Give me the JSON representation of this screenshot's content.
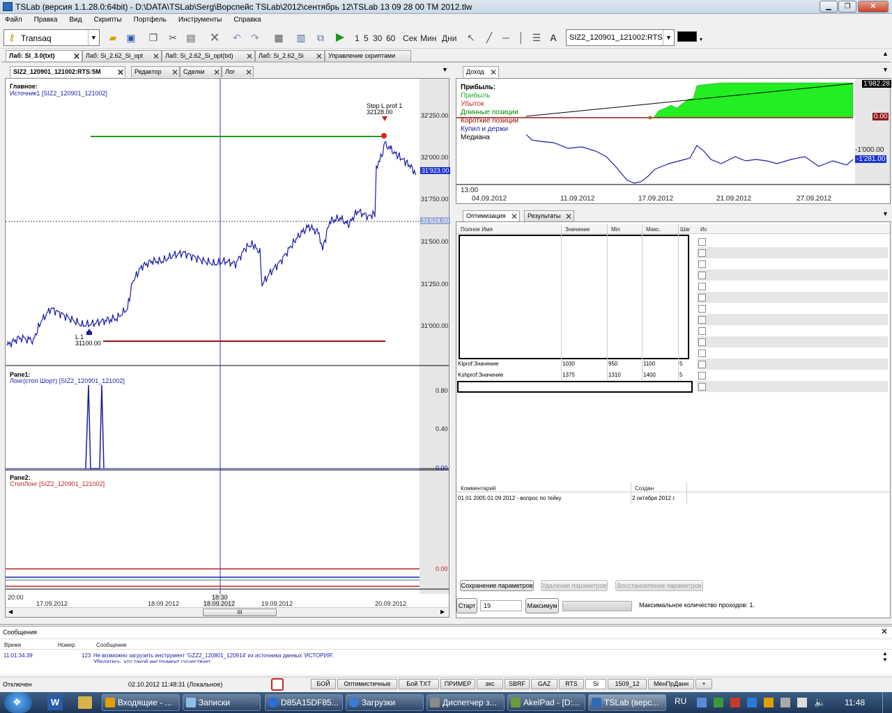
{
  "window": {
    "title": "TSLab (версия 1.1.28.0:64bit) - D:\\DATA\\TSLab\\Serg\\Ворспейс TSLab\\2012\\сентябрь 12\\TSLab 13 09   28 00  TM 2012.tlw"
  },
  "menu": [
    "Файл",
    "Правка",
    "Вид",
    "Скрипты",
    "Портфель",
    "Инструменты",
    "Справка"
  ],
  "toolbar": {
    "connection": "Transaq",
    "intervals": [
      "1",
      "5",
      "30",
      "60"
    ],
    "units": [
      "Сек",
      "Мин",
      "Дни"
    ],
    "instrument": "SIZ2_120901_121002:RTS"
  },
  "doc_tabs": [
    "Лаб: SI_3.0(txt)",
    "Лаб: Si_2.62_Si_opt",
    "Лаб: Si_2.62_Si_opt(txt)",
    "Лаб: Si_2.62_Si",
    "Управление скриптами"
  ],
  "left_tabs": [
    "SIZ2_120901_121002:RTS:5M",
    "Редактор",
    "Сделки",
    "Лог"
  ],
  "main_pane": {
    "title": "Главное:",
    "source": "Источник1 [SIZ2_120901_121002]",
    "yticks": [
      "32'250.00",
      "32'000.00",
      "31'750.00",
      "31'500.00",
      "31'250.00",
      "31'000.00"
    ],
    "last_price": "31'923.00",
    "level_price": "31'624.00",
    "stop_label": "Stop L prof 1",
    "stop_value": "32128.00",
    "entry_label": "L 1",
    "entry_value": "31100.00"
  },
  "pane1": {
    "title": "Pane1:",
    "source": "Лонг(стоп Шорт) [SIZ2_120901_121002]",
    "yticks": [
      "0.80",
      "0.40",
      "0.00"
    ]
  },
  "pane2": {
    "title": "Pane2:",
    "source": "СтопЛонг [SIZ2_120901_121002]",
    "ytick": "0.00"
  },
  "time_axis": {
    "time": "20:00",
    "dates": [
      "17.09.2012",
      "18.09.2012",
      "19.09.2012",
      "20.09.2012"
    ],
    "cursor_time": "18:30",
    "cursor_date": "18.09.2012"
  },
  "profit_panel": {
    "tab": "Доход",
    "legend_title": "Прибыль:",
    "legend": [
      {
        "label": "Прибыль",
        "color": "#22aa22"
      },
      {
        "label": "Убыток",
        "color": "#cc2222"
      },
      {
        "label": "Длинные позиции",
        "color": "#008800"
      },
      {
        "label": "Короткие позиции",
        "color": "#aa0000"
      },
      {
        "label": "Купил и держи",
        "color": "#1a1aaa"
      },
      {
        "label": "Медиана",
        "color": "#000000"
      }
    ],
    "value_top": "1'982.28",
    "value_zero": "0.00",
    "value_m1000": "-1'000.00",
    "value_bh": "-1'281.00",
    "time": "13:00",
    "dates": [
      "04.09.2012",
      "11.09.2012",
      "17.09.2012",
      "21.09.2012",
      "27.09.2012"
    ]
  },
  "opt_panel": {
    "tabs": [
      "Оптимизация",
      "Результаты"
    ],
    "headers": [
      "Полное Имя",
      "Значение",
      "Min",
      "Макс.",
      "Шаг",
      "Ис"
    ],
    "rows": [
      {
        "name": "Klprof:Значение",
        "value": "1030",
        "min": "950",
        "max": "1100",
        "step": "5"
      },
      {
        "name": "Kshprof:Значение",
        "value": "1375",
        "min": "1310",
        "max": "1400",
        "step": "5"
      }
    ],
    "comment_headers": [
      "Комментарий",
      "Создан"
    ],
    "comment": {
      "text": "01 01 2005 01 09 2012 - вопрос по тейку",
      "created": "2 октября 2012 г."
    },
    "buttons": {
      "save": "Сохранение параметров",
      "delete": "Удаление параметров",
      "restore": "Восстановление параметров",
      "start": "Старт",
      "maximum": "Максимум"
    },
    "start_value": "19",
    "max_runs": "Максимальное количество проходов: 1."
  },
  "messages": {
    "title": "Сообщения",
    "headers": [
      "Время",
      "Номер",
      "Сообщение"
    ],
    "row": {
      "time": "11:01:34.39",
      "number": "123",
      "text": "Не возможно загрузить инструмент 'GZZ2_120801_120914' из источника данных 'ИСТОРИЯ'.",
      "text2": "Убедитесь, что такой инструмент существует"
    }
  },
  "status": {
    "connection": "Отключен",
    "datetime": "02.10.2012 11:48:31 (Локальное)"
  },
  "bottom_tabs": [
    "БОЙ",
    "Оптимистичные",
    "Бой TXT",
    "ПРИМЕР",
    "экс",
    "SBRF",
    "GAZ",
    "RTS",
    "Si",
    "1509_12",
    "МенПрДанн",
    "+"
  ],
  "taskbar": {
    "items": [
      "Входящие - ...",
      "Записки",
      "D85A15DF85...",
      "Загрузки",
      "Диспетчер з...",
      "AkelPad - [D:...",
      "TSLab (верс..."
    ],
    "lang": "RU",
    "clock": "11:48"
  },
  "colors": {
    "price_line": "#1a1aaa",
    "profit_fill": "#22ee22",
    "stop_line": "#8b1a1a",
    "take_line": "#1aa01a",
    "cursor": "#3333cc"
  }
}
